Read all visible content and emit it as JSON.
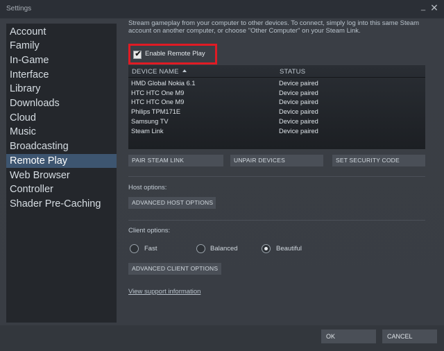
{
  "window": {
    "title": "Settings",
    "minimize_label": "_",
    "close_label": "✕"
  },
  "sidebar": {
    "items": [
      {
        "label": "Account"
      },
      {
        "label": "Family"
      },
      {
        "label": "In-Game"
      },
      {
        "label": "Interface"
      },
      {
        "label": "Library"
      },
      {
        "label": "Downloads"
      },
      {
        "label": "Cloud"
      },
      {
        "label": "Music"
      },
      {
        "label": "Broadcasting"
      },
      {
        "label": "Remote Play",
        "active": true
      },
      {
        "label": "Web Browser"
      },
      {
        "label": "Controller"
      },
      {
        "label": "Shader Pre-Caching"
      }
    ]
  },
  "main": {
    "description": "Stream gameplay from your computer to other devices. To connect, simply log into this same Steam account on another computer, or choose \"Other Computer\" on your Steam Link.",
    "enable_remote_play": {
      "label": "Enable Remote Play",
      "checked": true,
      "check_glyph": "✔"
    },
    "device_table": {
      "columns": {
        "name": "DEVICE NAME",
        "status": "STATUS"
      },
      "sort_icon": "sort-ascending-icon",
      "rows": [
        {
          "name": "HMD Global Nokia 6.1",
          "status": "Device paired"
        },
        {
          "name": "HTC HTC One M9",
          "status": "Device paired"
        },
        {
          "name": "HTC HTC One M9",
          "status": "Device paired"
        },
        {
          "name": "Philips TPM171E",
          "status": "Device paired"
        },
        {
          "name": "Samsung TV",
          "status": "Device paired"
        },
        {
          "name": "Steam Link",
          "status": "Device paired"
        }
      ]
    },
    "buttons": {
      "pair_steam_link": "PAIR STEAM LINK",
      "unpair_devices": "UNPAIR DEVICES",
      "set_security_code": "SET SECURITY CODE",
      "advanced_host_options": "ADVANCED HOST OPTIONS",
      "advanced_client_options": "ADVANCED CLIENT OPTIONS"
    },
    "host_options_label": "Host options:",
    "client_options_label": "Client options:",
    "client_quality": {
      "options": [
        "Fast",
        "Balanced",
        "Beautiful"
      ],
      "selected": "Beautiful"
    },
    "support_link": "View support information"
  },
  "footer": {
    "ok": "OK",
    "cancel": "CANCEL"
  },
  "colors": {
    "accent_active": "#3d5570",
    "highlight_border": "#e01b24",
    "background": "#393d44",
    "sidebar_bg": "#24272c"
  }
}
